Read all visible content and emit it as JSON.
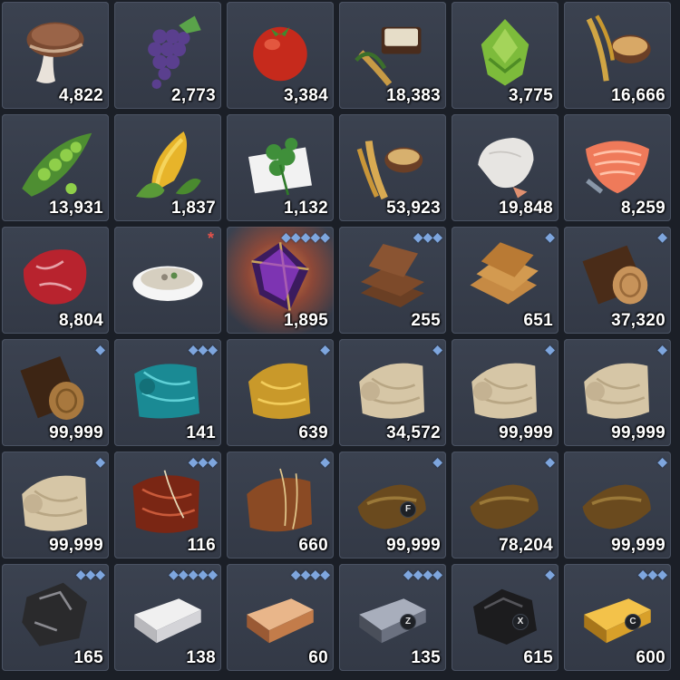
{
  "inventory": [
    {
      "name": "mushroom",
      "icon": "mushroom-icon",
      "qty": "4,822"
    },
    {
      "name": "grapes",
      "icon": "grapes-icon",
      "qty": "2,773"
    },
    {
      "name": "tomato",
      "icon": "tomato-icon",
      "qty": "3,384"
    },
    {
      "name": "grain-sack",
      "icon": "grain-sack-icon",
      "qty": "18,383"
    },
    {
      "name": "hops",
      "icon": "hops-icon",
      "qty": "3,775"
    },
    {
      "name": "barley",
      "icon": "barley-icon",
      "qty": "16,666"
    },
    {
      "name": "peas",
      "icon": "peas-icon",
      "qty": "13,931"
    },
    {
      "name": "corn",
      "icon": "corn-icon",
      "qty": "1,837"
    },
    {
      "name": "herb",
      "icon": "herb-icon",
      "qty": "1,132"
    },
    {
      "name": "wheat",
      "icon": "wheat-icon",
      "qty": "53,923"
    },
    {
      "name": "shrimp",
      "icon": "shrimp-icon",
      "qty": "19,848"
    },
    {
      "name": "salmon",
      "icon": "salmon-icon",
      "qty": "8,259"
    },
    {
      "name": "steak",
      "icon": "steak-icon",
      "qty": "8,804"
    },
    {
      "name": "soup",
      "icon": "soup-icon",
      "qty": "",
      "star": "*"
    },
    {
      "name": "crystal",
      "icon": "purple-crystal-icon",
      "qty": "1,895",
      "tier": "◆◆◆◆◆",
      "glow": true
    },
    {
      "name": "plank-dark",
      "icon": "dark-plank-icon",
      "qty": "255",
      "tier": "◆◆◆"
    },
    {
      "name": "plank-light",
      "icon": "light-plank-icon",
      "qty": "651",
      "tier": "◆"
    },
    {
      "name": "log",
      "icon": "log-icon",
      "qty": "37,320",
      "tier": "◆"
    },
    {
      "name": "log-dark",
      "icon": "dark-log-icon",
      "qty": "99,999",
      "tier": "◆"
    },
    {
      "name": "teal-cloth",
      "icon": "teal-cloth-icon",
      "qty": "141",
      "tier": "◆◆◆"
    },
    {
      "name": "gold-cloth",
      "icon": "gold-cloth-icon",
      "qty": "639",
      "tier": "◆"
    },
    {
      "name": "linen-1",
      "icon": "linen-cloth-icon",
      "qty": "34,572",
      "tier": "◆"
    },
    {
      "name": "linen-2",
      "icon": "linen-cloth-icon",
      "qty": "99,999",
      "tier": "◆"
    },
    {
      "name": "linen-3",
      "icon": "linen-cloth-icon",
      "qty": "99,999",
      "tier": "◆"
    },
    {
      "name": "linen-4",
      "icon": "linen-cloth-icon",
      "qty": "99,999",
      "tier": "◆"
    },
    {
      "name": "red-silk",
      "icon": "red-silk-icon",
      "qty": "116",
      "tier": "◆◆◆"
    },
    {
      "name": "leather-roll",
      "icon": "leather-roll-icon",
      "qty": "660",
      "tier": "◆"
    },
    {
      "name": "hide-1",
      "icon": "hide-icon",
      "qty": "99,999",
      "tier": "◆",
      "key": "F"
    },
    {
      "name": "hide-2",
      "icon": "hide-icon",
      "qty": "78,204",
      "tier": "◆"
    },
    {
      "name": "hide-3",
      "icon": "hide-icon",
      "qty": "99,999",
      "tier": "◆"
    },
    {
      "name": "ore",
      "icon": "ore-icon",
      "qty": "165",
      "tier": "◆◆◆"
    },
    {
      "name": "silver-ingot",
      "icon": "silver-ingot-icon",
      "qty": "138",
      "tier": "◆◆◆◆◆"
    },
    {
      "name": "bronze-ingot",
      "icon": "bronze-ingot-icon",
      "qty": "60",
      "tier": "◆◆◆◆"
    },
    {
      "name": "steel-ingot",
      "icon": "steel-ingot-icon",
      "qty": "135",
      "tier": "◆◆◆◆",
      "key": "Z"
    },
    {
      "name": "coal",
      "icon": "coal-icon",
      "qty": "615",
      "tier": "◆",
      "key": "X"
    },
    {
      "name": "gold-ingot",
      "icon": "gold-ingot-icon",
      "qty": "600",
      "tier": "◆◆◆",
      "key": "C"
    }
  ]
}
